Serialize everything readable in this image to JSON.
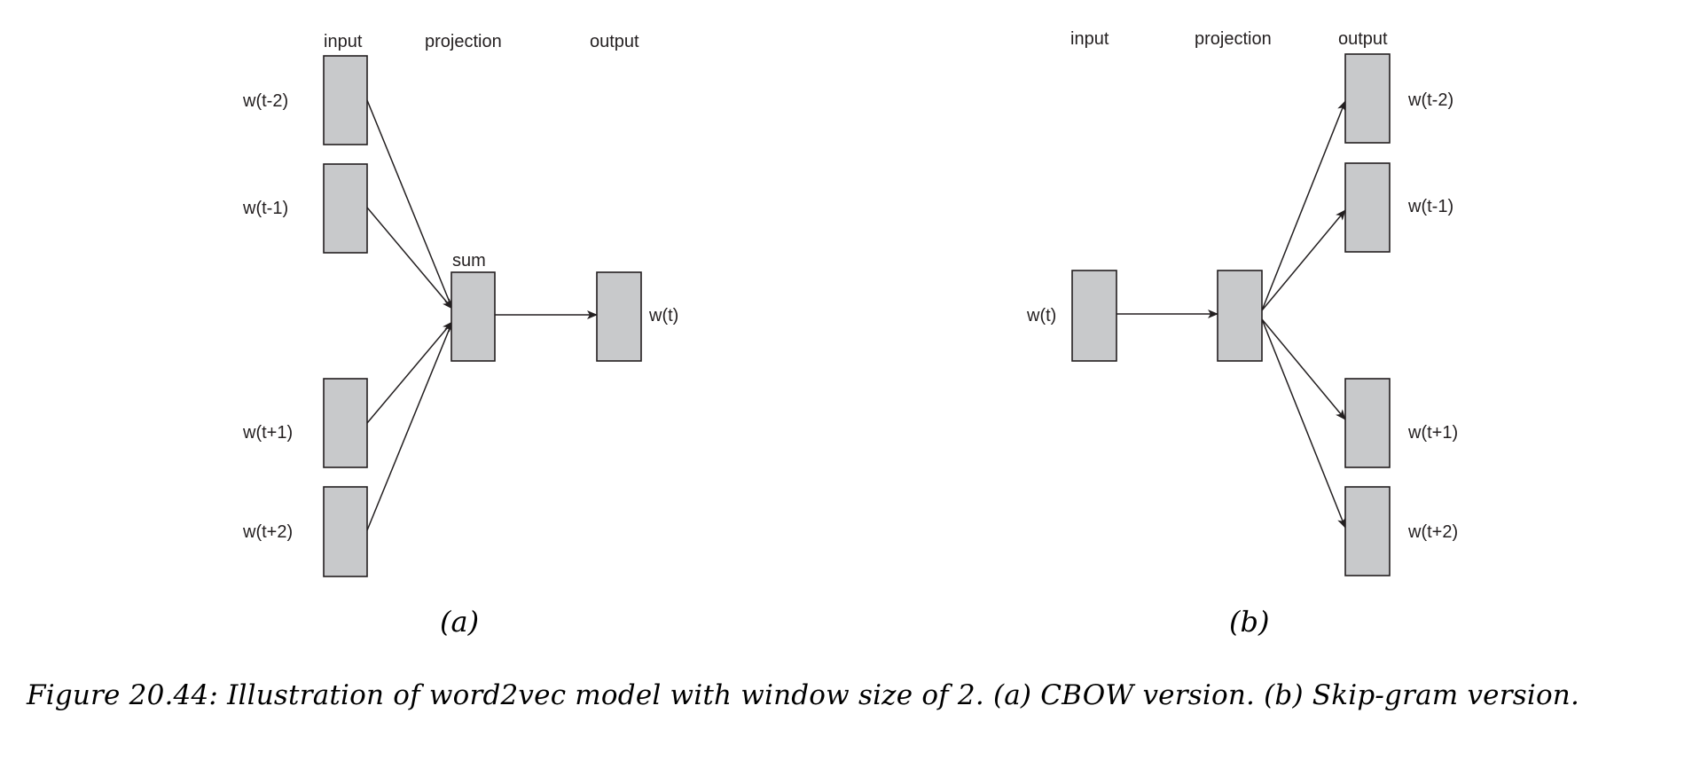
{
  "figure": {
    "panel_a": {
      "subfigure_label": "(a)",
      "variant": "CBOW",
      "column_headers": {
        "input": "input",
        "projection": "projection",
        "output": "output"
      },
      "projection_label": "sum",
      "input_nodes": [
        {
          "id": "a-in-0",
          "label": "w(t-2)"
        },
        {
          "id": "a-in-1",
          "label": "w(t-1)"
        },
        {
          "id": "a-in-2",
          "label": "w(t+1)"
        },
        {
          "id": "a-in-3",
          "label": "w(t+2)"
        }
      ],
      "projection_node": {
        "id": "a-proj",
        "label": ""
      },
      "output_nodes": [
        {
          "id": "a-out-0",
          "label": "w(t)"
        }
      ],
      "edges": [
        {
          "from": "a-in-0",
          "to": "a-proj"
        },
        {
          "from": "a-in-1",
          "to": "a-proj"
        },
        {
          "from": "a-in-2",
          "to": "a-proj"
        },
        {
          "from": "a-in-3",
          "to": "a-proj"
        },
        {
          "from": "a-proj",
          "to": "a-out-0"
        }
      ]
    },
    "panel_b": {
      "subfigure_label": "(b)",
      "variant": "Skip-gram",
      "column_headers": {
        "input": "input",
        "projection": "projection",
        "output": "output"
      },
      "input_nodes": [
        {
          "id": "b-in-0",
          "label": "w(t)"
        }
      ],
      "projection_node": {
        "id": "b-proj",
        "label": ""
      },
      "output_nodes": [
        {
          "id": "b-out-0",
          "label": "w(t-2)"
        },
        {
          "id": "b-out-1",
          "label": "w(t-1)"
        },
        {
          "id": "b-out-2",
          "label": "w(t+1)"
        },
        {
          "id": "b-out-3",
          "label": "w(t+2)"
        }
      ],
      "edges": [
        {
          "from": "b-in-0",
          "to": "b-proj"
        },
        {
          "from": "b-proj",
          "to": "b-out-0"
        },
        {
          "from": "b-proj",
          "to": "b-out-1"
        },
        {
          "from": "b-proj",
          "to": "b-out-2"
        },
        {
          "from": "b-proj",
          "to": "b-out-3"
        }
      ]
    },
    "caption": "Figure 20.44: Illustration of word2vec model with window size of 2. (a) CBOW version. (b) Skip-gram version."
  },
  "colors": {
    "node_fill": "#c8c9cb",
    "stroke": "#231f20"
  }
}
